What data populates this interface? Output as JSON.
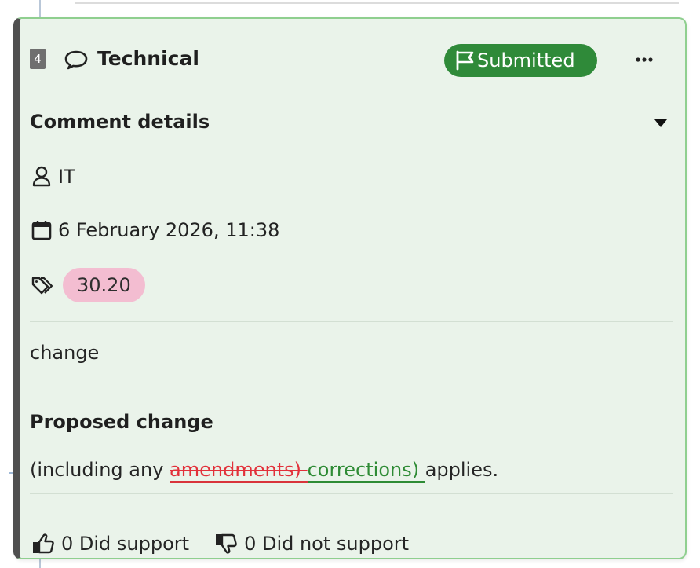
{
  "card": {
    "number": "4",
    "type_icon": "comment-icon",
    "category": "Technical",
    "status": {
      "icon": "flag-icon",
      "label": "Submitted",
      "color": "#2f8a39"
    },
    "more_icon": "more-options-icon",
    "details": {
      "title": "Comment details",
      "toggle_icon": "caret-down-icon",
      "author": {
        "icon": "user-icon",
        "value": "IT"
      },
      "date": {
        "icon": "calendar-icon",
        "value": "6 February 2026, 11:38"
      },
      "tags": {
        "icon": "tags-icon",
        "items": [
          {
            "label": "30.20",
            "color": "#f3bdd1"
          }
        ]
      }
    },
    "comment_text": "change",
    "proposed_change": {
      "title": "Proposed change",
      "prefix": "(including any ",
      "deleted": "amendments) ",
      "inserted": "corrections) ",
      "suffix": "applies.",
      "deleted_color": "#e2303a",
      "inserted_color": "#2e8b35"
    },
    "support": {
      "did_support": {
        "icon": "thumbs-up-icon",
        "label": "0 Did support"
      },
      "did_not_support": {
        "icon": "thumbs-down-icon",
        "label": "0 Did not support"
      }
    }
  },
  "colors": {
    "card_background": "#eaf3ea",
    "card_border": "#8fcf8f",
    "card_left_border": "#4f4f4f"
  }
}
